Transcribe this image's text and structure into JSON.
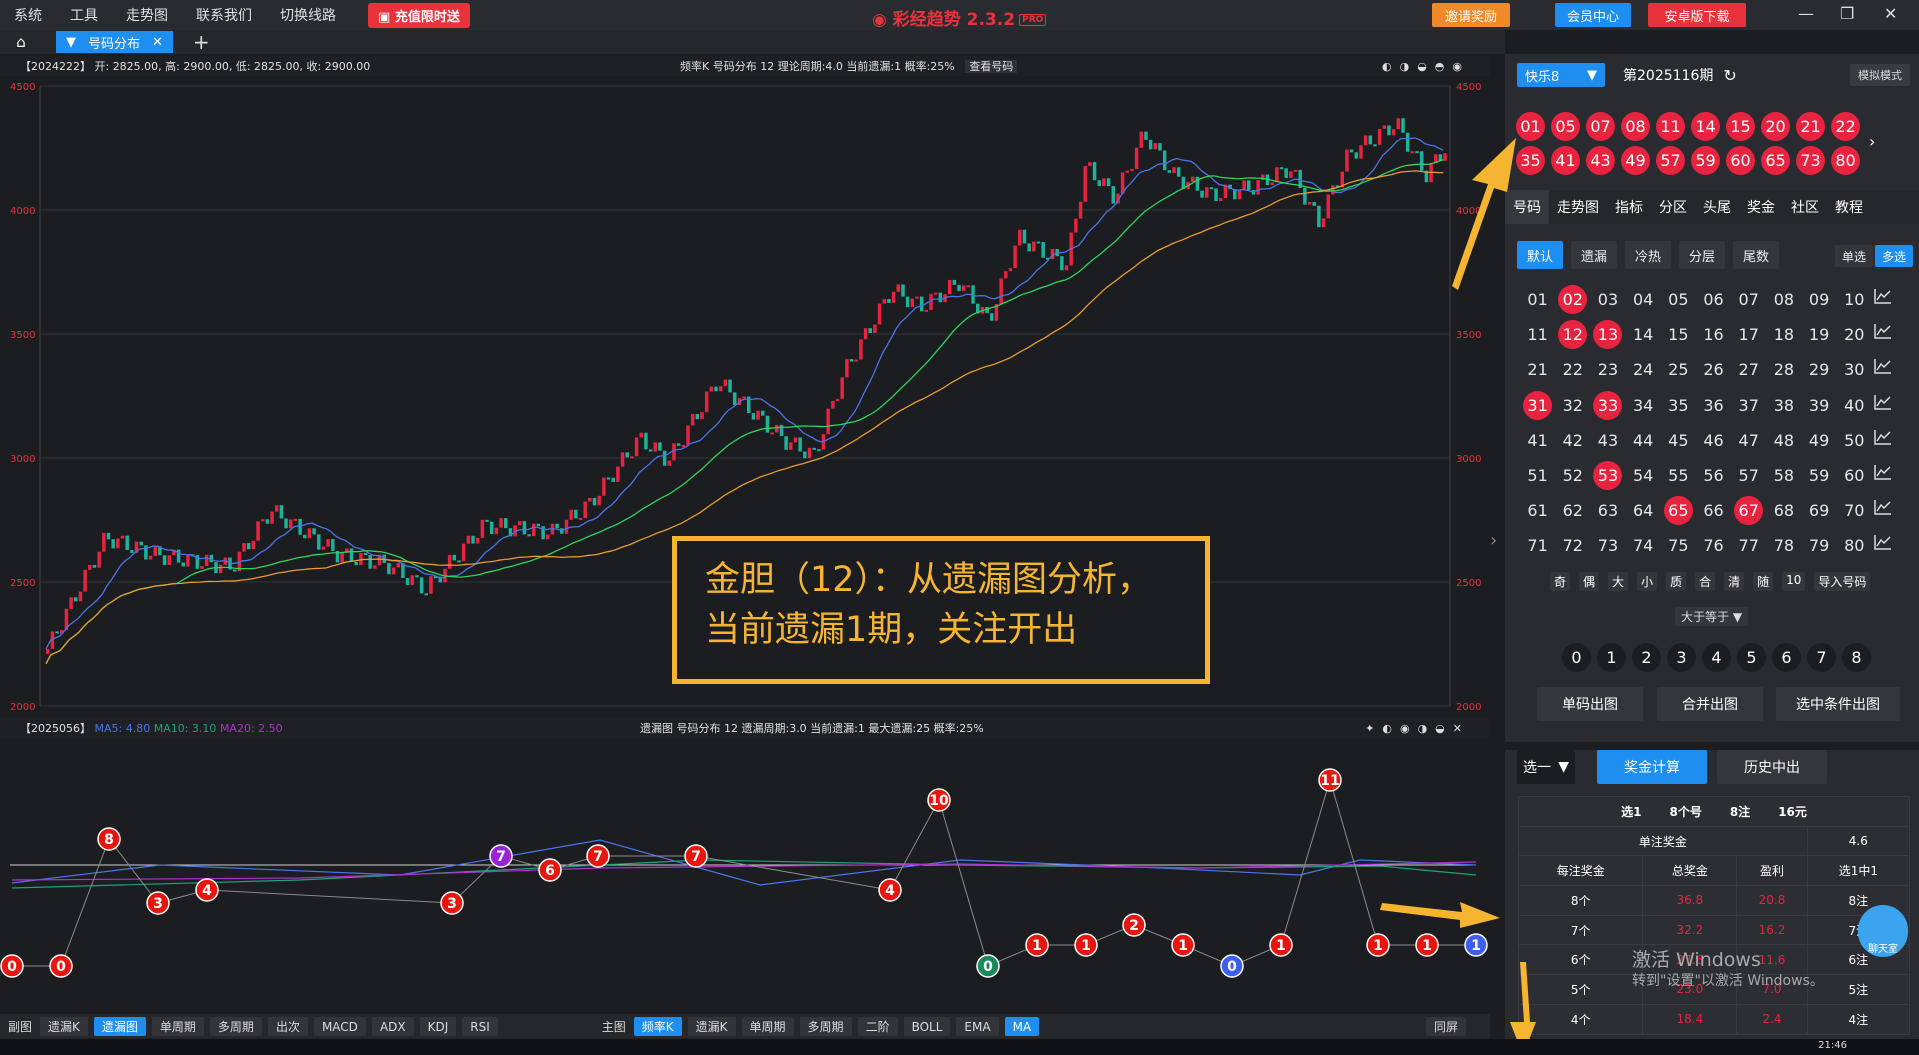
{
  "menu": [
    "系统",
    "工具",
    "走势图",
    "联系我们",
    "切换线路"
  ],
  "recharge_label": "充值限时送",
  "app_title": "彩经趋势 2.3.2",
  "app_badge": "PRO",
  "header_buttons": {
    "invite": "邀请奖励",
    "member": "会员中心",
    "android": "安卓版下载"
  },
  "tab": {
    "label": "号码分布"
  },
  "kpanel": {
    "left_info": "【2024222】 开: 2825.00, 高: 2900.00, 低: 2825.00, 收: 2900.00",
    "center_info": "频率K   号码分布  12     理论周期:4.0   当前遗漏:1   概率:25%",
    "view_btn": "查看号码",
    "y_ticks": [
      "4500",
      "4000",
      "3500",
      "3000",
      "2500",
      "2000"
    ]
  },
  "overlay": {
    "line1": "金胆（12）：从遗漏图分析，",
    "line2": "当前遗漏1期，关注开出"
  },
  "mpanel": {
    "id": "【2025056】",
    "ma5": "MA5: 4.80",
    "ma10": "MA10: 3.10",
    "ma20": "MA20: 2.50",
    "center_info": "遗漏图   号码分布  12     遗漏周期:3.0  当前遗漏:1   最大遗漏:25   概率:25%"
  },
  "miss_values": [
    0,
    0,
    8,
    3,
    4,
    null,
    null,
    null,
    null,
    3,
    7,
    6,
    7,
    null,
    7,
    null,
    null,
    null,
    4,
    10,
    0,
    1,
    1,
    2,
    1,
    0,
    1,
    11,
    1,
    1,
    1
  ],
  "miss_special": {
    "10": "purple",
    "20": "green",
    "25": "blue",
    "30": "blue"
  },
  "miss_x": [
    12,
    61,
    109,
    158,
    207,
    256,
    305,
    354,
    403,
    452,
    501,
    550,
    598,
    647,
    696,
    744,
    793,
    842,
    890,
    939,
    988,
    1037,
    1086,
    1134,
    1183,
    1232,
    1281,
    1330,
    1378,
    1427,
    1476
  ],
  "miss_fill": [
    0,
    1,
    2,
    4,
    7,
    8,
    null,
    null,
    null,
    null,
    10,
    11,
    12,
    null,
    14,
    null,
    null,
    null,
    18,
    19,
    20,
    21,
    22,
    23,
    24,
    25,
    26,
    27,
    28,
    29,
    30
  ],
  "bottom_left_label": "副图",
  "bottom_left": [
    "遗漏K",
    "遗漏图",
    "单周期",
    "多周期",
    "出次",
    "MACD",
    "ADX",
    "KDJ",
    "RSI"
  ],
  "bottom_left_on": 1,
  "bottom_mid_label": "主图",
  "bottom_mid": [
    "频率K",
    "遗漏K",
    "单周期",
    "多周期",
    "二阶",
    "BOLL",
    "EMA",
    "MA"
  ],
  "bottom_mid_on": [
    0,
    7
  ],
  "bottom_right": "同屏",
  "sidebar": {
    "lottery": "快乐8",
    "period": "第2025116期",
    "sim": "模拟模式",
    "drawn_row1": [
      "01",
      "05",
      "07",
      "08",
      "11",
      "14",
      "15",
      "20",
      "21",
      "22"
    ],
    "drawn_row2": [
      "35",
      "41",
      "43",
      "49",
      "57",
      "59",
      "60",
      "65",
      "73",
      "80"
    ],
    "nav": [
      "号码",
      "走势图",
      "指标",
      "分区",
      "头尾",
      "奖金",
      "社区",
      "教程"
    ],
    "filters": [
      "默认",
      "遗漏",
      "冷热",
      "分层",
      "尾数"
    ],
    "single": "单选",
    "multi": "多选",
    "selected": [
      2,
      12,
      13,
      31,
      33,
      53,
      65,
      67
    ],
    "misc_filters": [
      "奇",
      "偶",
      "大",
      "小",
      "质",
      "合",
      "清",
      "随",
      "10",
      "导入号码"
    ],
    "ge_label": "大于等于",
    "digits": [
      "0",
      "1",
      "2",
      "3",
      "4",
      "5",
      "6",
      "7",
      "8"
    ],
    "actions": [
      "单码出图",
      "合并出图",
      "选中条件出图"
    ],
    "select_one": "选一",
    "calc": "奖金计算",
    "history": "历史中出",
    "table": {
      "summary": [
        "选1",
        "8个号",
        "8注",
        "16元"
      ],
      "single_prize_label": "单注奖金",
      "single_prize": "4.6",
      "headers": [
        "每注奖金",
        "总奖金",
        "盈利",
        "选1中1"
      ],
      "rows": [
        [
          "8个",
          "36.8",
          "20.8",
          "8注"
        ],
        [
          "7个",
          "32.2",
          "16.2",
          "7注"
        ],
        [
          "6个",
          "27.6",
          "11.6",
          "6注"
        ],
        [
          "5个",
          "23.0",
          "7.0",
          "5注"
        ],
        [
          "4个",
          "18.4",
          "2.4",
          "4注"
        ]
      ]
    }
  },
  "watermark": {
    "line1": "激活 Windows",
    "line2": "转到\"设置\"以激活 Windows。"
  },
  "chat": "聊天室",
  "clock": "21:46"
}
